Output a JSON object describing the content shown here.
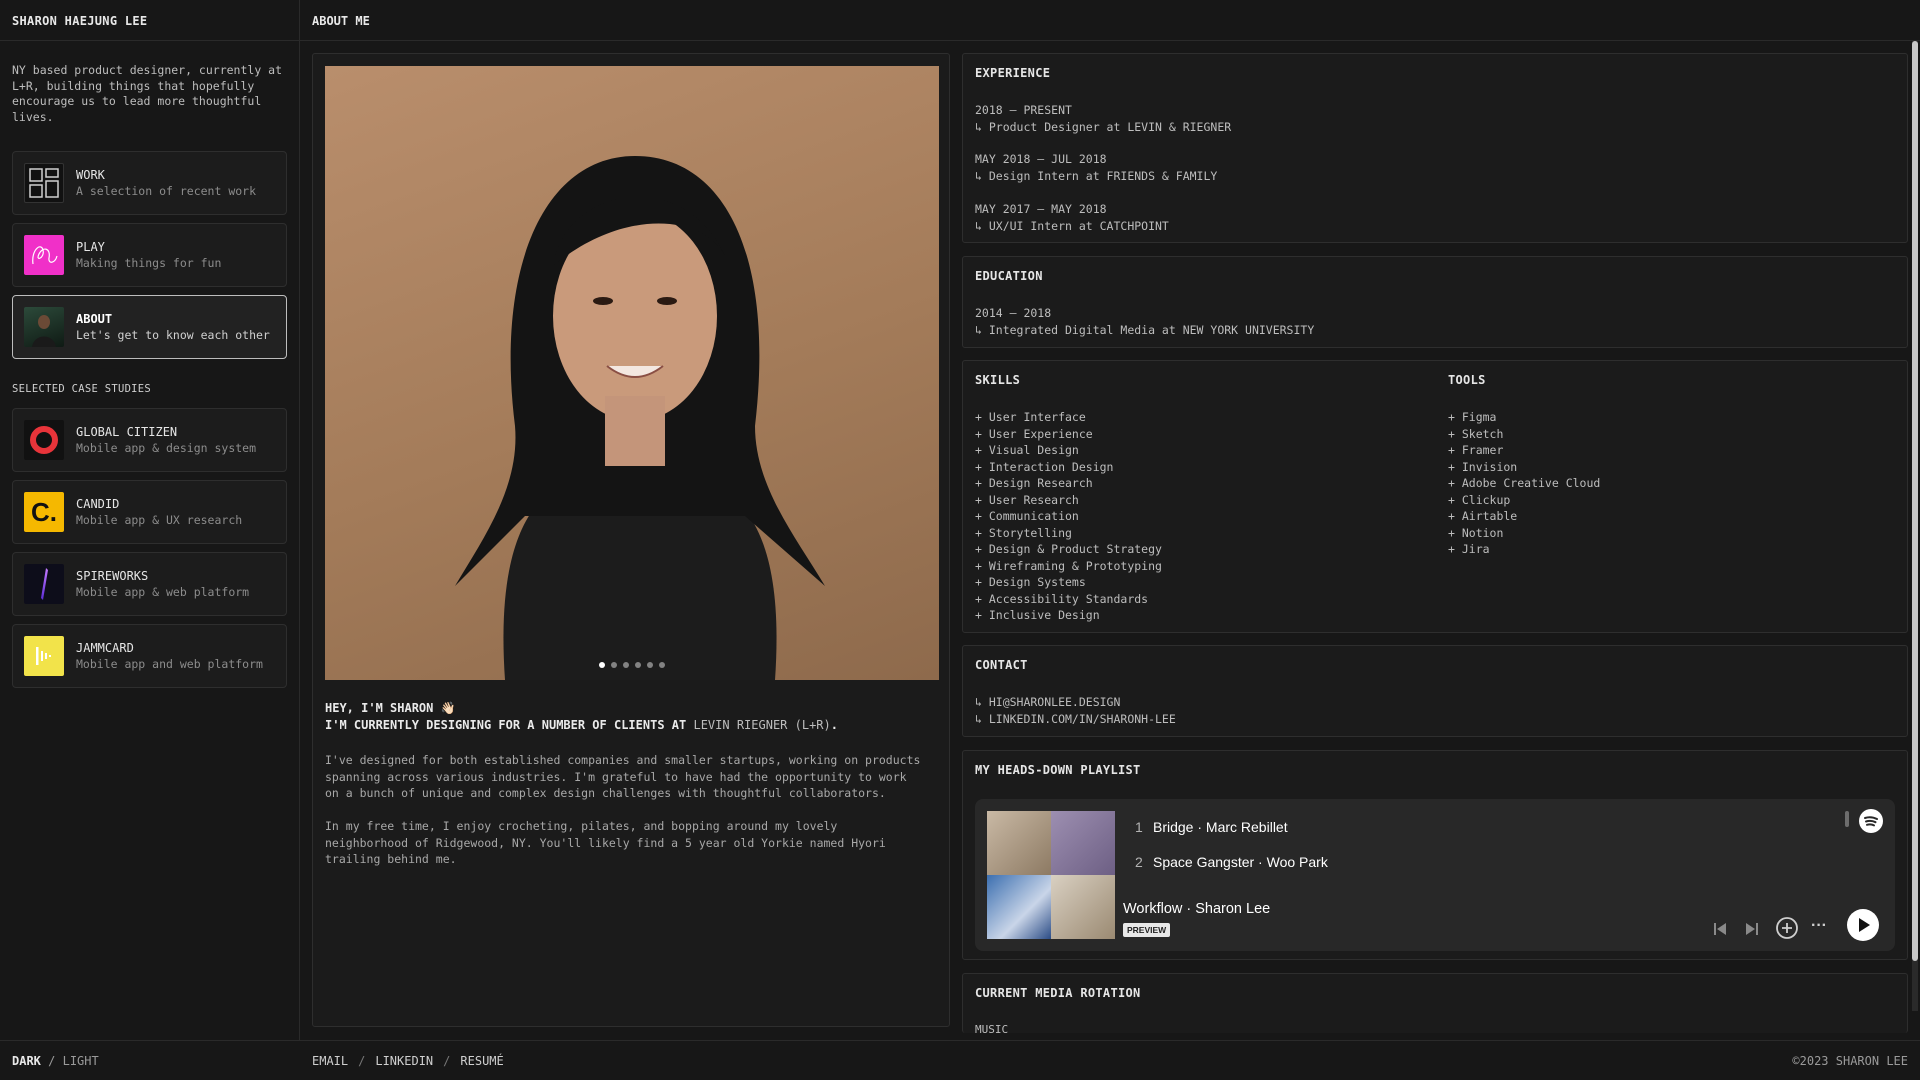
{
  "sidebar": {
    "name": "SHARON HAEJUNG LEE",
    "intro": "NY based product designer, currently at L+R, building things that hopefully encourage us to lead more thoughtful lives.",
    "nav": [
      {
        "title": "WORK",
        "subtitle": "A selection of recent work"
      },
      {
        "title": "PLAY",
        "subtitle": "Making things for fun"
      },
      {
        "title": "ABOUT",
        "subtitle": "Let's get to know each other"
      }
    ],
    "section_label": "SELECTED CASE STUDIES",
    "cases": [
      {
        "title": "GLOBAL CITIZEN",
        "subtitle": "Mobile app & design system",
        "logo_text": ""
      },
      {
        "title": "CANDID",
        "subtitle": "Mobile app & UX research",
        "logo_text": "C."
      },
      {
        "title": "SPIREWORKS",
        "subtitle": "Mobile app & web platform",
        "logo_text": ""
      },
      {
        "title": "JAMMCARD",
        "subtitle": "Mobile app and web platform",
        "logo_text": ""
      }
    ]
  },
  "header": {
    "title": "ABOUT ME"
  },
  "about": {
    "hey": "HEY, I'M SHARON 👋🏻",
    "designing_prefix": "I'M CURRENTLY DESIGNING FOR A NUMBER OF CLIENTS AT",
    "client_link": "LEVIN RIEGNER (L+R)",
    "designing_suffix": ".",
    "para1": "I've designed for both established companies and smaller startups, working on products spanning across various industries. I'm grateful to have had the opportunity to work on a bunch of unique and complex design challenges with thoughtful collaborators.",
    "para2": "In my free time, I enjoy crocheting, pilates, and bopping around my lovely neighborhood of Ridgewood, NY. You'll likely find a 5 year old Yorkie named Hyori trailing behind me.",
    "carousel_count": 6,
    "carousel_active": 1
  },
  "experience": {
    "title": "EXPERIENCE",
    "items": [
      {
        "dates": "2018 – PRESENT",
        "role": "↳ Product Designer at LEVIN & RIEGNER"
      },
      {
        "dates": "MAY 2018 – JUL 2018",
        "role": "↳ Design Intern at FRIENDS & FAMILY"
      },
      {
        "dates": "MAY 2017 – MAY 2018",
        "role": "↳ UX/UI Intern at CATCHPOINT"
      }
    ]
  },
  "education": {
    "title": "EDUCATION",
    "dates": "2014 – 2018",
    "degree": "↳ Integrated Digital Media at NEW YORK UNIVERSITY"
  },
  "skills": {
    "title": "SKILLS",
    "items": [
      "+ User Interface",
      "+ User Experience",
      "+ Visual Design",
      "+ Interaction Design",
      "+ Design Research",
      "+ User Research",
      "+ Communication",
      "+ Storytelling",
      "+ Design & Product Strategy",
      "+ Wireframing & Prototyping",
      "+ Design Systems",
      "+ Accessibility Standards",
      "+ Inclusive Design"
    ]
  },
  "tools": {
    "title": "TOOLS",
    "items": [
      "+ Figma",
      "+ Sketch",
      "+ Framer",
      "+ Invision",
      "+ Adobe Creative Cloud",
      "+ Clickup",
      "+ Airtable",
      "+ Notion",
      "+ Jira"
    ]
  },
  "contact": {
    "title": "CONTACT",
    "email": "↳ HI@SHARONLEE.DESIGN",
    "linkedin": "↳ LINKEDIN.COM/IN/SHARONH-LEE"
  },
  "playlist": {
    "title": "MY HEADS-DOWN PLAYLIST",
    "tracks": [
      {
        "num": "1",
        "name": "Bridge · Marc Rebillet"
      },
      {
        "num": "2",
        "name": "Space Gangster · Woo Park"
      }
    ],
    "playlist_name": "Workflow · Sharon Lee",
    "badge": "PREVIEW"
  },
  "media": {
    "title": "CURRENT MEDIA ROTATION",
    "first_label": "MUSIC"
  },
  "footer": {
    "mode_dark": "DARK",
    "mode_sep": "/",
    "mode_light": "LIGHT",
    "links": [
      "EMAIL",
      "LINKEDIN",
      "RESUMÉ"
    ],
    "link_sep": "/",
    "copyright": "©2023 SHARON LEE"
  },
  "colors": {
    "background": "#171717",
    "panel": "#1b1b1b",
    "border": "#2e2e2e",
    "spotify": "#282828",
    "play_pink": "#f030c8",
    "candid_yellow": "#f5b800",
    "jammcard_yellow": "#f2e34a",
    "global_citizen_red": "#e8343a"
  }
}
